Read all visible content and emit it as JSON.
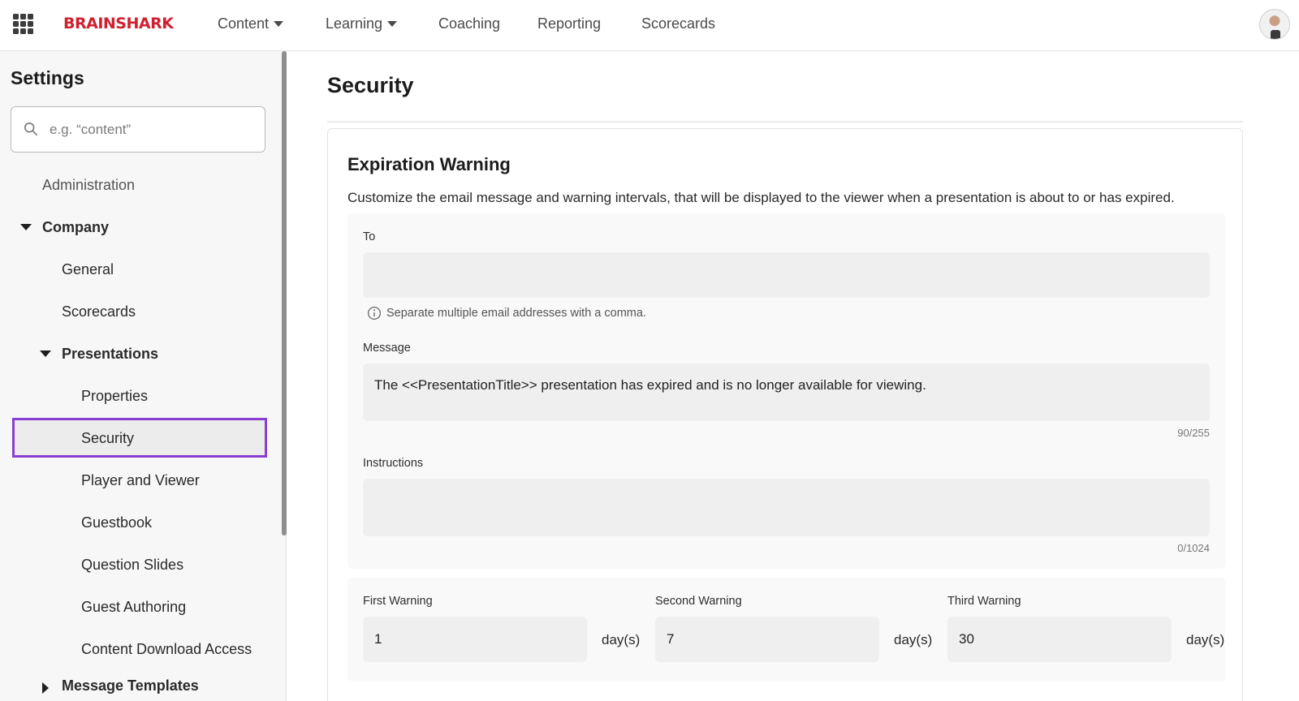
{
  "nav": {
    "brand": "BRAINSHARK",
    "items": [
      {
        "label": "Content",
        "has_dropdown": true
      },
      {
        "label": "Learning",
        "has_dropdown": true
      },
      {
        "label": "Coaching",
        "has_dropdown": false
      },
      {
        "label": "Reporting",
        "has_dropdown": false
      },
      {
        "label": "Scorecards",
        "has_dropdown": false
      }
    ],
    "apps_icon": "grid-9-dots-icon",
    "brand_color": "#d0202f"
  },
  "sidebar": {
    "title": "Settings",
    "search": {
      "placeholder": "e.g. “content”",
      "value": ""
    },
    "items": [
      {
        "label": "Administration",
        "level": 0,
        "expandable": false
      },
      {
        "label": "Company",
        "level": 0,
        "expandable": true,
        "expanded": true
      },
      {
        "label": "General",
        "level": 1
      },
      {
        "label": "Scorecards",
        "level": 1
      },
      {
        "label": "Presentations",
        "level": 1,
        "expandable": true,
        "expanded": true
      },
      {
        "label": "Properties",
        "level": 2
      },
      {
        "label": "Security",
        "level": 2,
        "selected": true
      },
      {
        "label": "Player and Viewer",
        "level": 2
      },
      {
        "label": "Guestbook",
        "level": 2
      },
      {
        "label": "Question Slides",
        "level": 2
      },
      {
        "label": "Guest Authoring",
        "level": 2
      },
      {
        "label": "Content Download Access",
        "level": 2
      },
      {
        "label": "Message Templates",
        "level": 1,
        "expandable": true,
        "expanded": false
      }
    ],
    "selection_color": "#8a3fd1"
  },
  "main": {
    "page_title": "Security",
    "section": {
      "title": "Expiration Warning",
      "description": "Customize the email message and warning intervals, that will be displayed to the viewer when a presentation is about to or has expired.",
      "to": {
        "label": "To",
        "value": "",
        "hint": "Separate multiple email addresses with a comma."
      },
      "message": {
        "label": "Message",
        "value": "The <<PresentationTitle>> presentation has expired and is no longer available for viewing.",
        "counter": "90/255"
      },
      "instructions": {
        "label": "Instructions",
        "value": "",
        "counter": "0/1024"
      },
      "warnings": [
        {
          "label": "First Warning",
          "value": "1",
          "unit": "day(s)"
        },
        {
          "label": "Second Warning",
          "value": "7",
          "unit": "day(s)"
        },
        {
          "label": "Third Warning",
          "value": "30",
          "unit": "day(s)"
        }
      ]
    }
  }
}
